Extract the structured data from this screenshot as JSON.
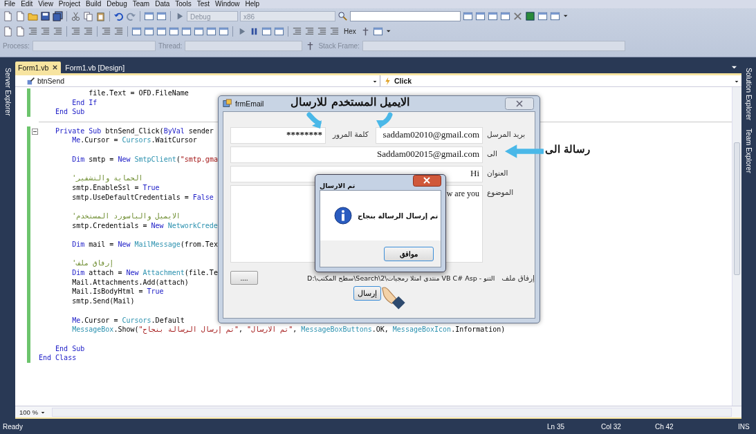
{
  "menu": [
    "File",
    "Edit",
    "View",
    "Project",
    "Build",
    "Debug",
    "Team",
    "Data",
    "Tools",
    "Test",
    "Window",
    "Help"
  ],
  "toolbar": {
    "configuration": "Debug",
    "platform": "x86",
    "hex_button": "Hex",
    "process_label": "Process:",
    "thread_label": "Thread:",
    "stack_frame_label": "Stack Frame:"
  },
  "left_panel": {
    "title": "Server Explorer"
  },
  "right_panel": {
    "items": [
      "Solution Explorer",
      "Team Explorer"
    ]
  },
  "tabs": [
    {
      "label": "Form1.vb",
      "selected": true,
      "closable": true
    },
    {
      "label": "Form1.vb [Design]",
      "selected": false,
      "closable": false
    }
  ],
  "editor": {
    "class_dropdown": "btnSend",
    "method_dropdown": "Click",
    "zoom": "100 %",
    "lines": [
      {
        "modified": true,
        "tokens": [
          {
            "kind": "plain",
            "text": "            file.Text = OFD.FileName"
          }
        ]
      },
      {
        "modified": true,
        "tokens": [
          {
            "kind": "keyword",
            "text": "        End If"
          }
        ]
      },
      {
        "modified": true,
        "tokens": [
          {
            "kind": "keyword",
            "text": "    End Sub"
          }
        ]
      },
      {
        "modified": true,
        "separator_before": true,
        "collapsible": true,
        "tokens": [
          {
            "kind": "keyword",
            "text": "    Private Sub"
          },
          {
            "kind": "plain",
            "text": " btnSend_Click("
          },
          {
            "kind": "keyword",
            "text": "ByVal"
          },
          {
            "kind": "plain",
            "text": " sender"
          }
        ]
      },
      {
        "modified": true,
        "tokens": [
          {
            "kind": "keyword",
            "text": "        Me"
          },
          {
            "kind": "plain",
            "text": ".Cursor = "
          },
          {
            "kind": "type",
            "text": "Cursors"
          },
          {
            "kind": "plain",
            "text": ".WaitCursor"
          }
        ]
      },
      {
        "modified": true,
        "blank_before": true,
        "tokens": [
          {
            "kind": "keyword",
            "text": "        Dim"
          },
          {
            "kind": "plain",
            "text": " smtp = "
          },
          {
            "kind": "keyword",
            "text": "New"
          },
          {
            "kind": "type",
            "text": " SmtpClient"
          },
          {
            "kind": "plain",
            "text": "("
          },
          {
            "kind": "string",
            "text": "\"smtp.gma"
          }
        ]
      },
      {
        "modified": true,
        "blank_before": true,
        "tokens": [
          {
            "kind": "comment",
            "text": "        'الحماية والتشفير"
          }
        ]
      },
      {
        "modified": true,
        "tokens": [
          {
            "kind": "plain",
            "text": "        smtp.EnableSsl = "
          },
          {
            "kind": "keyword",
            "text": "True"
          }
        ]
      },
      {
        "modified": true,
        "tokens": [
          {
            "kind": "plain",
            "text": "        smtp.UseDefaultCredentials = "
          },
          {
            "kind": "keyword",
            "text": "False"
          }
        ]
      },
      {
        "modified": true,
        "blank_before": true,
        "tokens": [
          {
            "kind": "comment",
            "text": "        'الايميل والباسورد المستخدم"
          }
        ]
      },
      {
        "modified": true,
        "tokens": [
          {
            "kind": "plain",
            "text": "        smtp.Credentials = "
          },
          {
            "kind": "keyword",
            "text": "New"
          },
          {
            "kind": "type",
            "text": " NetworkCrede"
          }
        ]
      },
      {
        "modified": true,
        "blank_before": true,
        "tokens": [
          {
            "kind": "keyword",
            "text": "        Dim"
          },
          {
            "kind": "plain",
            "text": " mail = "
          },
          {
            "kind": "keyword",
            "text": "New"
          },
          {
            "kind": "type",
            "text": " MailMessage"
          },
          {
            "kind": "plain",
            "text": "(from.Tex"
          }
        ]
      },
      {
        "modified": true,
        "blank_before": true,
        "tokens": [
          {
            "kind": "comment",
            "text": "        'إرفاق ملف"
          }
        ]
      },
      {
        "modified": true,
        "tokens": [
          {
            "kind": "keyword",
            "text": "        Dim"
          },
          {
            "kind": "plain",
            "text": " attach = "
          },
          {
            "kind": "keyword",
            "text": "New"
          },
          {
            "kind": "type",
            "text": " Attachment"
          },
          {
            "kind": "plain",
            "text": "(file.Te"
          }
        ]
      },
      {
        "modified": true,
        "tokens": [
          {
            "kind": "plain",
            "text": "        Mail.Attachments.Add(attach)"
          }
        ]
      },
      {
        "modified": true,
        "tokens": [
          {
            "kind": "plain",
            "text": "        Mail.IsBodyHtml = "
          },
          {
            "kind": "keyword",
            "text": "True"
          }
        ]
      },
      {
        "modified": true,
        "tokens": [
          {
            "kind": "plain",
            "text": "        smtp.Send(Mail)"
          }
        ]
      },
      {
        "modified": true,
        "blank_before": true,
        "tokens": [
          {
            "kind": "keyword",
            "text": "        Me"
          },
          {
            "kind": "plain",
            "text": ".Cursor = "
          },
          {
            "kind": "type",
            "text": "Cursors"
          },
          {
            "kind": "plain",
            "text": ".Default"
          }
        ]
      },
      {
        "modified": true,
        "tokens": [
          {
            "kind": "type",
            "text": "        MessageBox"
          },
          {
            "kind": "plain",
            "text": ".Show("
          },
          {
            "kind": "string",
            "text": "\"تم إرسال الرسالة بنجاح\""
          },
          {
            "kind": "plain",
            "text": ", "
          },
          {
            "kind": "string",
            "text": "\"تم الارسال\""
          },
          {
            "kind": "plain",
            "text": ", "
          },
          {
            "kind": "type",
            "text": "MessageBoxButtons"
          },
          {
            "kind": "plain",
            "text": ".OK, "
          },
          {
            "kind": "type",
            "text": "MessageBoxIcon"
          },
          {
            "kind": "plain",
            "text": ".Information)"
          }
        ]
      },
      {
        "modified": true,
        "blank_before": true,
        "tokens": [
          {
            "kind": "keyword",
            "text": "    End Sub"
          }
        ]
      },
      {
        "modified": true,
        "tokens": [
          {
            "kind": "keyword",
            "text": "End Class"
          }
        ]
      }
    ]
  },
  "form_window": {
    "title": "frmEmail",
    "sender_label": "بريد المرسل",
    "sender": "saddam02010@gmail.com",
    "password_label": "كلمة المرور",
    "password": "********",
    "to_label": "الى",
    "to": "Saddam002015@gmail.com",
    "subject_label": "العنوان",
    "subject": "Hi",
    "body_label": "الموضوع",
    "body": "w are you",
    "attachment_label": "إرفاق ملف",
    "attachment_path": "D:\\سطح المكتب\\Search\\منتدى امتلا رمجيات\\2 VB C# Asp - التنو",
    "browse_button": "....",
    "send_button": "إرسال"
  },
  "message_box": {
    "title": "تم الارسال",
    "message": "تم إرسال الرسالة بنجاح",
    "ok_button": "موافق"
  },
  "annotations": [
    {
      "text": "الايميل المستخدم للارسال",
      "kind": "top"
    },
    {
      "text": "رسالة الى",
      "kind": "side"
    }
  ],
  "status_bar": {
    "message": "Ready",
    "line": "Ln 35",
    "column": "Col 32",
    "char": "Ch 42",
    "mode": "INS"
  }
}
